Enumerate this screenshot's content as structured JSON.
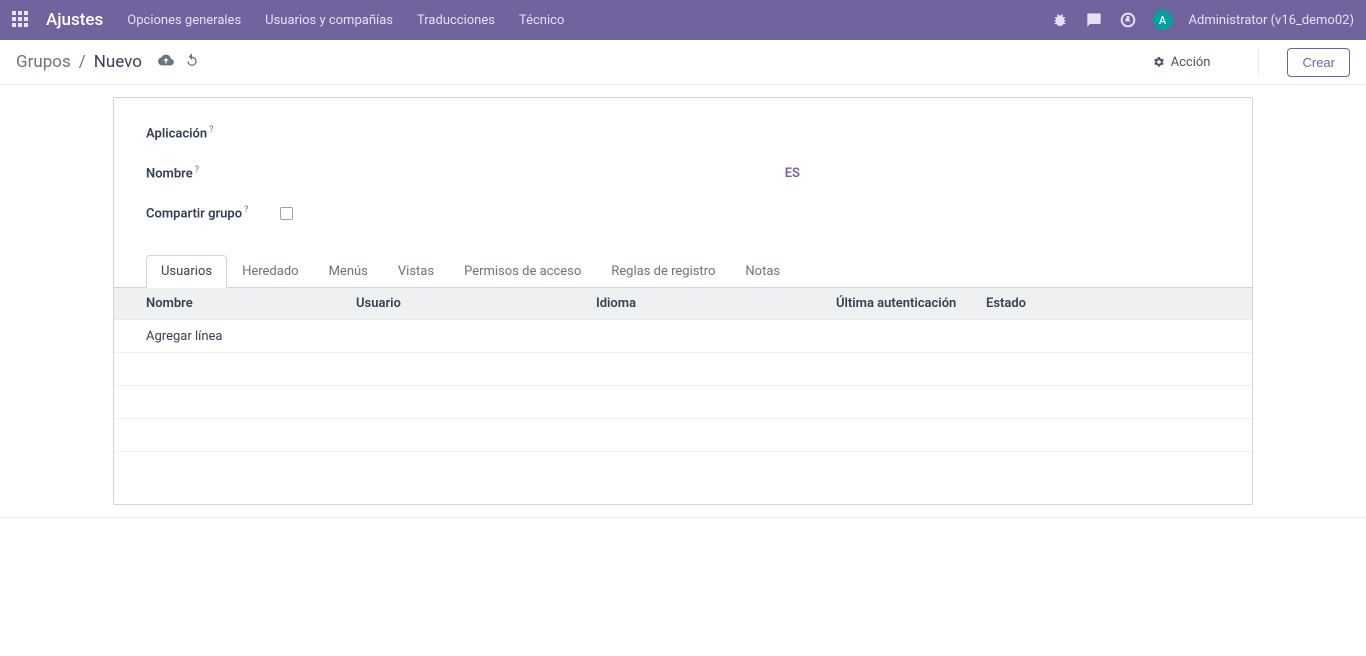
{
  "topbar": {
    "brand": "Ajustes",
    "user_initial": "A",
    "username": "Administrator (v16_demo02)",
    "nav": [
      {
        "label": "Opciones generales"
      },
      {
        "label": "Usuarios y compañías"
      },
      {
        "label": "Traducciones"
      },
      {
        "label": "Técnico"
      }
    ]
  },
  "breadcrumb": {
    "parent": "Grupos",
    "separator": "/",
    "current": "Nuevo"
  },
  "actions": {
    "action_label": "Acción",
    "create_label": "Crear"
  },
  "form": {
    "application_label": "Aplicación",
    "name_label": "Nombre",
    "share_label": "Compartir grupo",
    "help_symbol": "?",
    "lang_badge": "ES",
    "share_checked": false
  },
  "tabs": [
    {
      "label": "Usuarios",
      "active": true
    },
    {
      "label": "Heredado",
      "active": false
    },
    {
      "label": "Menús",
      "active": false
    },
    {
      "label": "Vistas",
      "active": false
    },
    {
      "label": "Permisos de acceso",
      "active": false
    },
    {
      "label": "Reglas de registro",
      "active": false
    },
    {
      "label": "Notas",
      "active": false
    }
  ],
  "columns": {
    "name": "Nombre",
    "user": "Usuario",
    "language": "Idioma",
    "last_auth": "Última autenticación",
    "state": "Estado"
  },
  "add_line_label": "Agregar línea"
}
